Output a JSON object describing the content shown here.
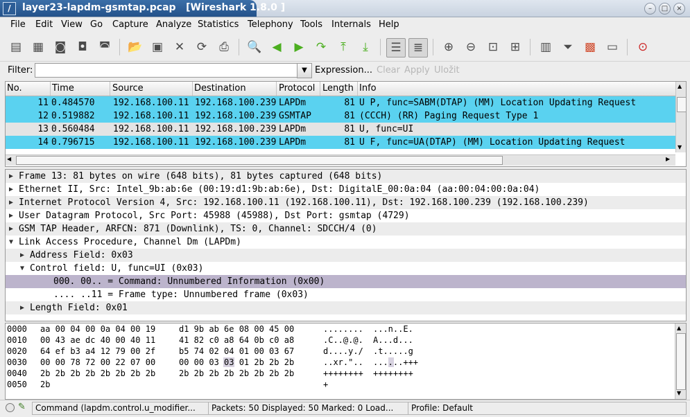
{
  "window": {
    "title": "layer23-lapdm-gsmtap.pcap   [Wireshark 1.8.0 ]"
  },
  "menu": [
    "File",
    "Edit",
    "View",
    "Go",
    "Capture",
    "Analyze",
    "Statistics",
    "Telephony",
    "Tools",
    "Internals",
    "Help"
  ],
  "filter": {
    "label": "Filter:",
    "value": "",
    "expression": "Expression...",
    "clear": "Clear",
    "apply": "Apply",
    "save": "Uložit"
  },
  "packet_list": {
    "columns": [
      "No.",
      "Time",
      "Source",
      "Destination",
      "Protocol",
      "Length",
      "Info"
    ],
    "rows": [
      {
        "no": "11",
        "time": "0.484570",
        "src": "192.168.100.11",
        "dst": "192.168.100.239",
        "proto": "LAPDm",
        "len": "81",
        "info": "U P, func=SABM(DTAP) (MM) Location Updating Request",
        "color": "#5ad2f0"
      },
      {
        "no": "12",
        "time": "0.519882",
        "src": "192.168.100.11",
        "dst": "192.168.100.239",
        "proto": "GSMTAP",
        "len": "81",
        "info": "(CCCH) (RR) Paging Request Type 1",
        "color": "#5ad2f0"
      },
      {
        "no": "13",
        "time": "0.560484",
        "src": "192.168.100.11",
        "dst": "192.168.100.239",
        "proto": "LAPDm",
        "len": "81",
        "info": "U, func=UI",
        "color": "#e4e4e4"
      },
      {
        "no": "14",
        "time": "0.796715",
        "src": "192.168.100.11",
        "dst": "192.168.100.239",
        "proto": "LAPDm",
        "len": "81",
        "info": "U F, func=UA(DTAP) (MM) Location Updating Request",
        "color": "#5ad2f0"
      }
    ]
  },
  "details": [
    {
      "text": "Frame 13: 81 bytes on wire (648 bits), 81 bytes captured (648 bits)",
      "indent": 0,
      "state": "collapsed"
    },
    {
      "text": "Ethernet II, Src: Intel_9b:ab:6e (00:19:d1:9b:ab:6e), Dst: DigitalE_00:0a:04 (aa:00:04:00:0a:04)",
      "indent": 0,
      "state": "collapsed"
    },
    {
      "text": "Internet Protocol Version 4, Src: 192.168.100.11 (192.168.100.11), Dst: 192.168.100.239 (192.168.100.239)",
      "indent": 0,
      "state": "collapsed"
    },
    {
      "text": "User Datagram Protocol, Src Port: 45988 (45988), Dst Port: gsmtap (4729)",
      "indent": 0,
      "state": "collapsed"
    },
    {
      "text": "GSM TAP Header, ARFCN: 871 (Downlink), TS: 0, Channel: SDCCH/4 (0)",
      "indent": 0,
      "state": "collapsed"
    },
    {
      "text": "Link Access Procedure, Channel Dm (LAPDm)",
      "indent": 0,
      "state": "expanded"
    },
    {
      "text": "Address Field: 0x03",
      "indent": 1,
      "state": "collapsed"
    },
    {
      "text": "Control field: U, func=UI (0x03)",
      "indent": 1,
      "state": "expanded"
    },
    {
      "text": "000. 00.. = Command: Unnumbered Information (0x00)",
      "indent": 2,
      "state": "leaf",
      "selected": true
    },
    {
      "text": ".... ..11 = Frame type: Unnumbered frame (0x03)",
      "indent": 2,
      "state": "leaf"
    },
    {
      "text": "Length Field: 0x01",
      "indent": 1,
      "state": "collapsed"
    }
  ],
  "bytes": [
    {
      "offset": "0000",
      "hex1": "aa 00 04 00 0a 04 00 19",
      "hex2": "d1 9b ab 6e 08 00 45 00",
      "ascii1": "........",
      "ascii2": "...n..E."
    },
    {
      "offset": "0010",
      "hex1": "00 43 ae dc 40 00 40 11",
      "hex2": "41 82 c0 a8 64 0b c0 a8",
      "ascii1": ".C..@.@.",
      "ascii2": "A...d..."
    },
    {
      "offset": "0020",
      "hex1": "64 ef b3 a4 12 79 00 2f",
      "hex2": "b5 74 02 04 01 00 03 67",
      "ascii1": "d....y./",
      "ascii2": ".t.....g"
    },
    {
      "offset": "0030",
      "hex1": "00 00 78 72 00 22 07 00",
      "hex2": "00 00 03 03 01 2b 2b 2b",
      "ascii1": "..xr.\"..",
      "ascii2": "......+++",
      "hl_index": 3
    },
    {
      "offset": "0040",
      "hex1": "2b 2b 2b 2b 2b 2b 2b 2b",
      "hex2": "2b 2b 2b 2b 2b 2b 2b 2b",
      "ascii1": "++++++++",
      "ascii2": "++++++++"
    },
    {
      "offset": "0050",
      "hex1": "2b",
      "hex2": "",
      "ascii1": "+",
      "ascii2": ""
    }
  ],
  "status": {
    "field": "Command (lapdm.control.u_modifier...",
    "packets": "Packets: 50 Displayed: 50 Marked: 0 Load...",
    "profile": "Profile: Default"
  }
}
